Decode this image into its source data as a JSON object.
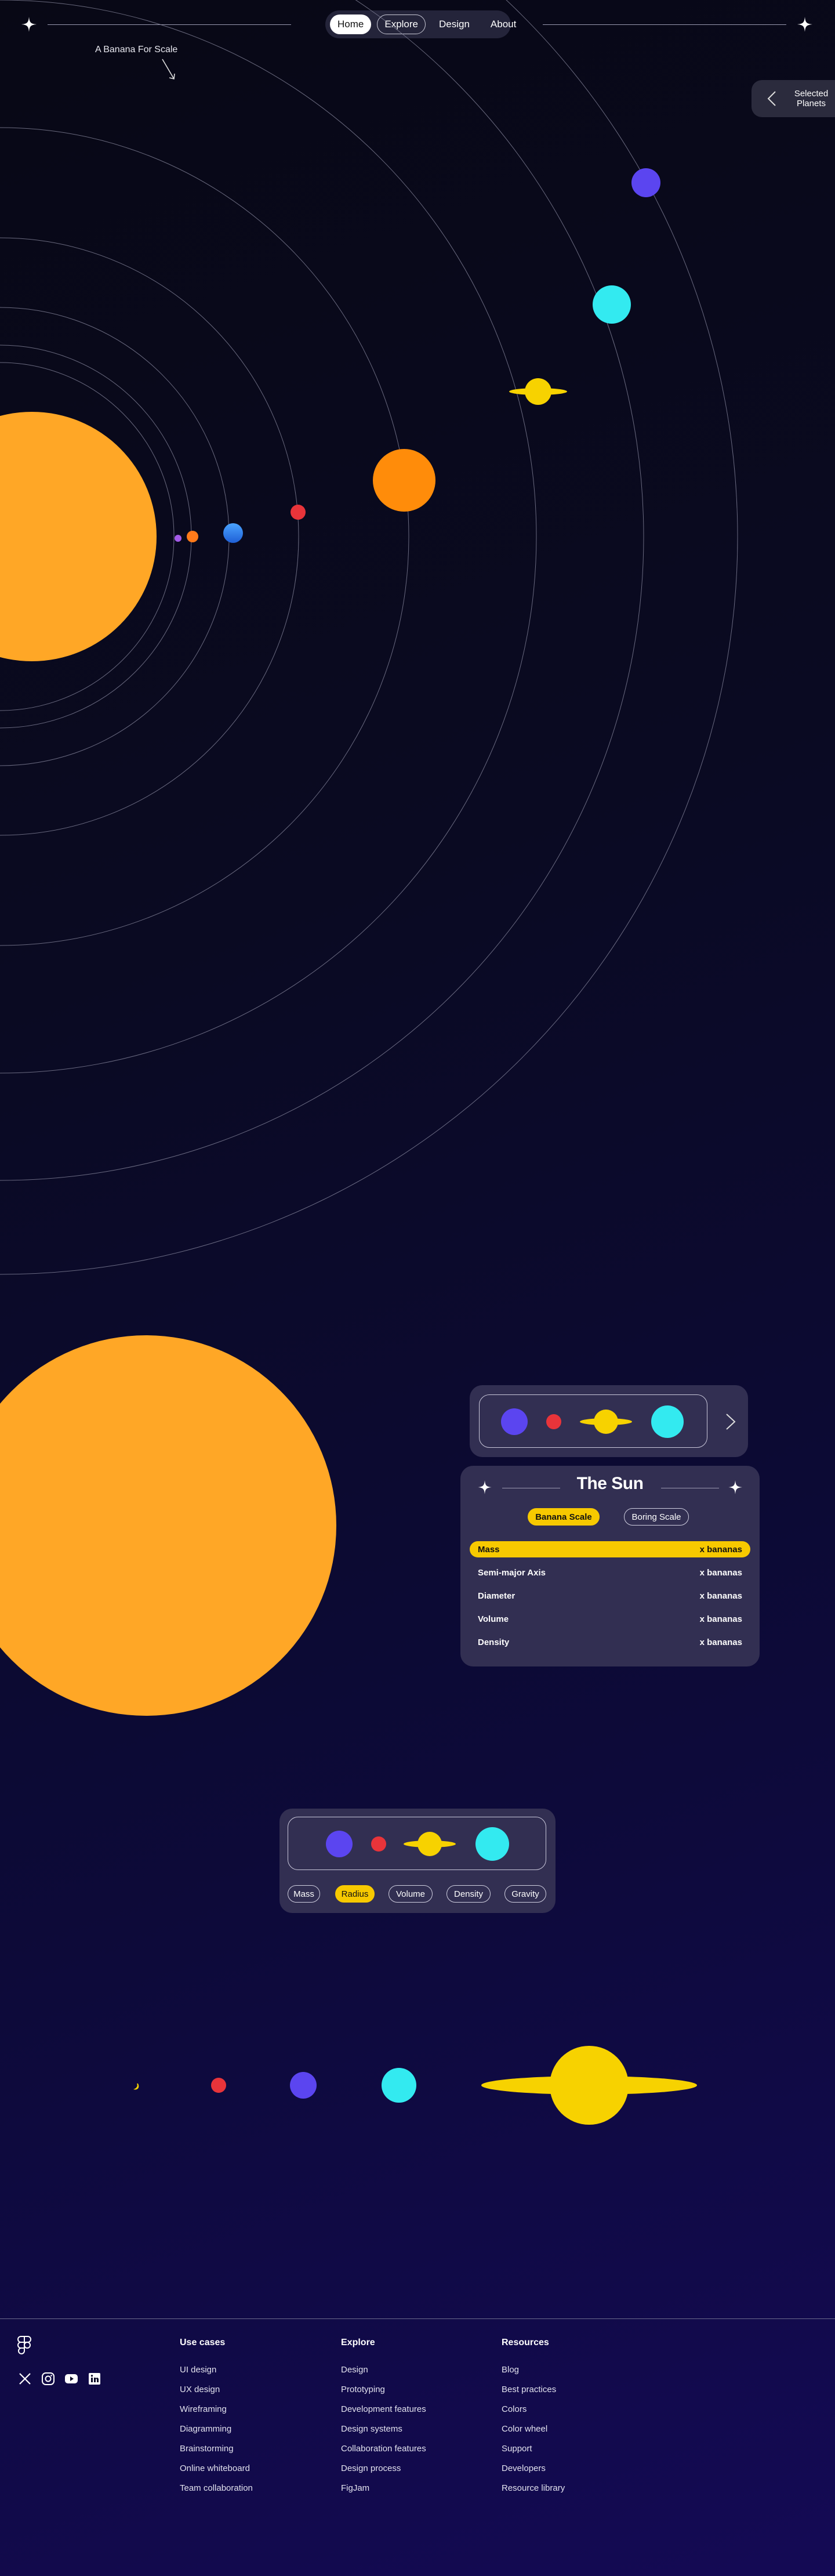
{
  "header": {
    "nav": [
      {
        "label": "Home",
        "state": "active"
      },
      {
        "label": "Explore",
        "state": "outlined"
      },
      {
        "label": "Design",
        "state": "normal"
      },
      {
        "label": "About",
        "state": "normal"
      }
    ]
  },
  "banana_label": "A Banana For Scale",
  "side_tab": {
    "label": "Selected Planets",
    "icon": "chevron-left-icon"
  },
  "card_sun": {
    "title": "The Sun",
    "toggles": [
      {
        "label": "Banana Scale",
        "active": true
      },
      {
        "label": "Boring Scale",
        "active": false
      }
    ],
    "rows": [
      {
        "label": "Mass",
        "value": "x bananas"
      },
      {
        "label": "Semi-major Axis",
        "value": "x bananas"
      },
      {
        "label": "Diameter",
        "value": "x bananas"
      },
      {
        "label": "Volume",
        "value": "x bananas"
      },
      {
        "label": "Density",
        "value": "x bananas"
      }
    ]
  },
  "compare_card": {
    "tabs": [
      {
        "label": "Mass",
        "active": false
      },
      {
        "label": "Radius",
        "active": true
      },
      {
        "label": "Volume",
        "active": false
      },
      {
        "label": "Density",
        "active": false
      },
      {
        "label": "Gravity",
        "active": false
      }
    ]
  },
  "colors": {
    "sun": "#ffa726",
    "mercury": "#a35be8",
    "venus": "#ff7a1a",
    "earth": "#3f8ef5",
    "mars": "#e8343a",
    "jupiter": "#ff8c0a",
    "saturn": "#f7d200",
    "uranus": "#33eaf0",
    "neptune": "#5b45f0",
    "accent": "#f7c900",
    "card": "#322f52"
  },
  "footer": {
    "social_icons": [
      "x-icon",
      "instagram-icon",
      "youtube-icon",
      "linkedin-icon"
    ],
    "columns": [
      {
        "heading": "Use cases",
        "links": [
          "UI design",
          "UX design",
          "Wireframing",
          "Diagramming",
          "Brainstorming",
          "Online whiteboard",
          "Team collaboration"
        ]
      },
      {
        "heading": "Explore",
        "links": [
          "Design",
          "Prototyping",
          "Development features",
          "Design systems",
          "Collaboration features",
          "Design process",
          "FigJam"
        ]
      },
      {
        "heading": "Resources",
        "links": [
          "Blog",
          "Best practices",
          "Colors",
          "Color wheel",
          "Support",
          "Developers",
          "Resource library"
        ]
      }
    ]
  }
}
